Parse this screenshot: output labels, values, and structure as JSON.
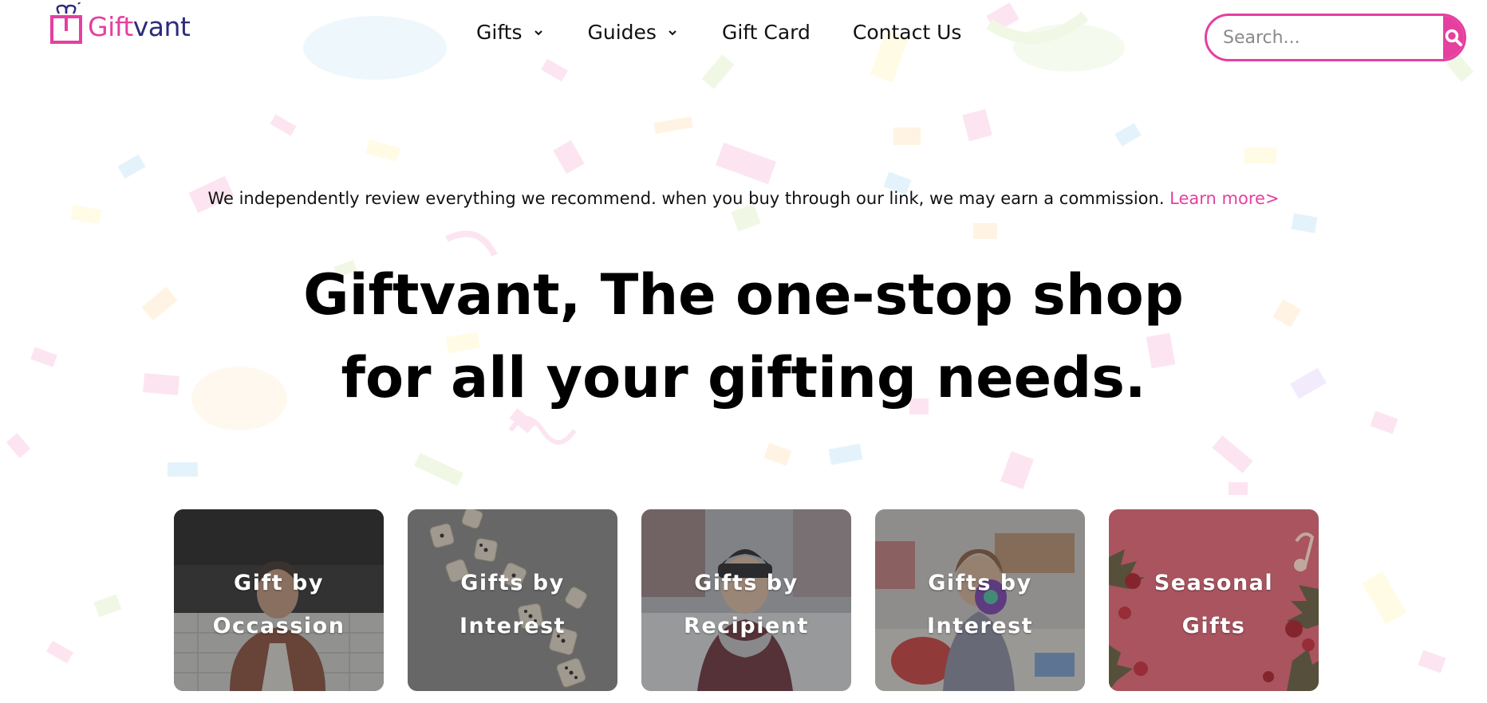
{
  "brand": {
    "name_part1": "Gift",
    "name_part2": "vant",
    "colors": {
      "pink": "#e53fa0",
      "navy": "#2d2b7e"
    }
  },
  "nav": {
    "items": [
      {
        "label": "Gifts",
        "has_dropdown": true
      },
      {
        "label": "Guides",
        "has_dropdown": true
      },
      {
        "label": "Gift Card",
        "has_dropdown": false
      },
      {
        "label": "Contact Us",
        "has_dropdown": false
      }
    ]
  },
  "search": {
    "placeholder": "Search...",
    "value": "",
    "icon": "search-icon"
  },
  "disclosure": {
    "text": "We independently review everything we recommend. when you buy through our link, we may earn a commission. ",
    "link": "Learn more>"
  },
  "hero": {
    "line1": "Giftvant, The one-stop shop",
    "line2": "for all your gifting needs."
  },
  "categories": [
    {
      "line1": "Gift by",
      "line2": "Occassion",
      "image": "man-portrait-photo"
    },
    {
      "line1": "Gifts by",
      "line2": "Interest",
      "image": "falling-dice-photo"
    },
    {
      "line1": "Gifts by",
      "line2": "Recipient",
      "image": "woman-in-beanie-photo"
    },
    {
      "line1": "Gifts by",
      "line2": "Interest",
      "image": "child-playing-photo"
    },
    {
      "line1": "Seasonal",
      "line2": "Gifts",
      "image": "christmas-ornaments-photo"
    }
  ]
}
